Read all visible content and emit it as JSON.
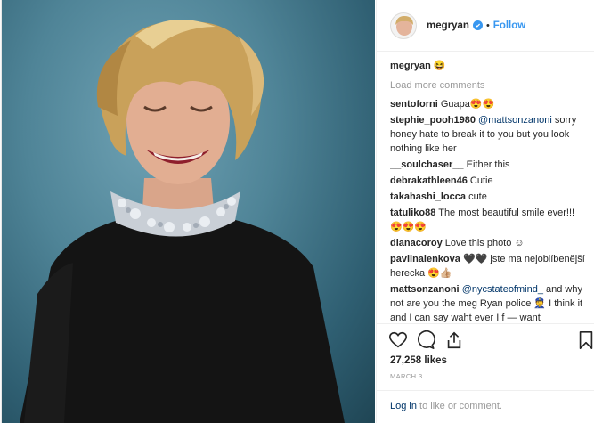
{
  "profile": {
    "username": "megryan",
    "follow_label": "Follow",
    "separator": "•"
  },
  "caption": {
    "username": "megryan",
    "text": "😆"
  },
  "load_more_label": "Load more comments",
  "comments": [
    {
      "user": "sentoforni",
      "text": "Guapa😍😍"
    },
    {
      "user": "stephie_pooh1980",
      "mention": "@mattsonzanoni",
      "text": " sorry honey hate to break it to you but you look nothing like her"
    },
    {
      "user": "__soulchaser__",
      "text": "Either this"
    },
    {
      "user": "debrakathleen46",
      "text": "Cutie"
    },
    {
      "user": "takahashi_locca",
      "text": "cute"
    },
    {
      "user": "tatuliko88",
      "text": "The most beautiful smile ever!!! 😍😍😍"
    },
    {
      "user": "dianacoroy",
      "text": "Love this photo ☺"
    },
    {
      "user": "pavlinalenkova",
      "text": "🖤🖤 jste ma nejoblíbenější herecka 😍👍🏼"
    },
    {
      "user": "mattsonzanoni",
      "mention": "@nycstateofmind_",
      "text": " and why not are you the meg Ryan police 👮 I think it and I can say waht ever I f — want"
    }
  ],
  "likes_text": "27,258 likes",
  "date_text": "MARCH 3",
  "footer": {
    "login_label": "Log in",
    "rest": " to like or comment."
  },
  "colors": {
    "accent": "#3897f0",
    "link": "#003569",
    "muted": "#999999"
  },
  "icons": [
    "heart-icon",
    "comment-icon",
    "share-icon",
    "bookmark-icon",
    "verified-badge-icon"
  ]
}
